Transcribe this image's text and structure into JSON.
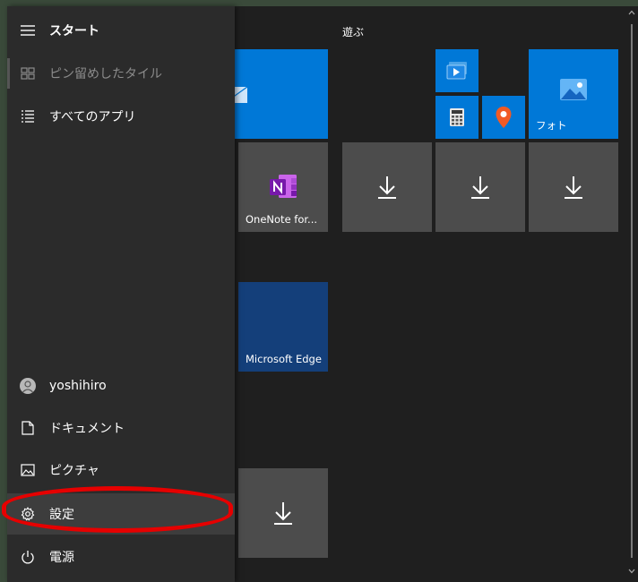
{
  "nav": {
    "menu_title": "スタート",
    "pinned_tiles": "ピン留めしたタイル",
    "all_apps": "すべてのアプリ",
    "user": "yoshihiro",
    "documents": "ドキュメント",
    "pictures": "ピクチャ",
    "settings": "設定",
    "power": "電源"
  },
  "tiles": {
    "group_play": "遊ぶ",
    "onenote": "OneNote for...",
    "edge": "Microsoft Edge",
    "photos": "フォト"
  },
  "colors": {
    "accent_blue": "#0078d7",
    "tile_gray": "#4c4c4c",
    "edge_navy": "#143f7a",
    "highlight_red": "#e60000"
  }
}
